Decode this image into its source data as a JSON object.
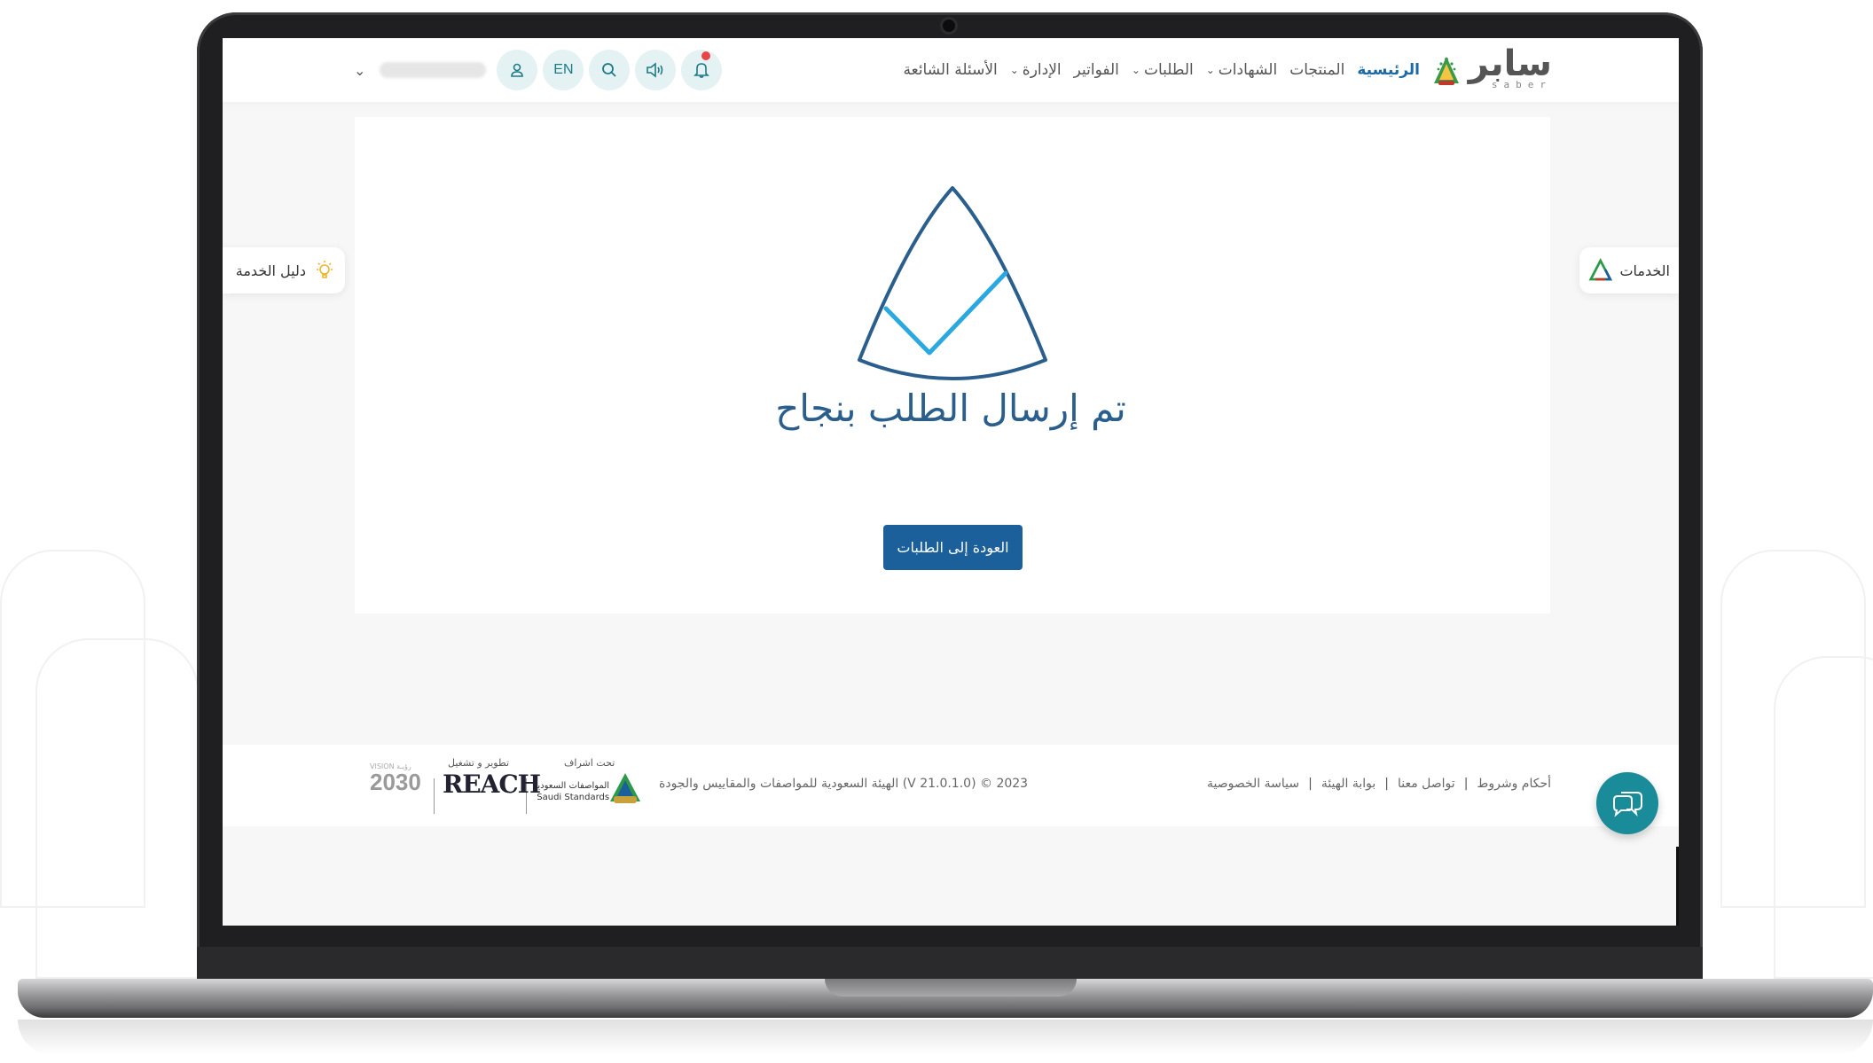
{
  "nav": {
    "logo_arabic": "سابر",
    "logo_latin": "saber",
    "items": [
      {
        "label": "الرئيسية",
        "active": true,
        "dropdown": false
      },
      {
        "label": "المنتجات",
        "active": false,
        "dropdown": false
      },
      {
        "label": "الشهادات",
        "active": false,
        "dropdown": true
      },
      {
        "label": "الطلبات",
        "active": false,
        "dropdown": true
      },
      {
        "label": "الفواتير",
        "active": false,
        "dropdown": false
      },
      {
        "label": "الإدارة",
        "active": false,
        "dropdown": true
      },
      {
        "label": "الأسئلة الشائعة",
        "active": false,
        "dropdown": false
      }
    ],
    "language_button": "EN",
    "icons": {
      "notifications": "bell-icon",
      "sound": "speaker-icon",
      "search": "search-icon",
      "user": "user-icon",
      "user_menu": "chevron-down-icon"
    }
  },
  "side_tabs": {
    "right_label": "الخدمات",
    "left_label": "دليل الخدمة"
  },
  "main": {
    "success_title": "تم إرسال الطلب بنجاح",
    "back_button": "العودة إلى الطلبات"
  },
  "footer": {
    "links": [
      "أحكام وشروط",
      "تواصل معنا",
      "بوابة الهيئة",
      "سياسة الخصوصية"
    ],
    "separator": "|",
    "copyright": "الهيئة السعودية للمواصفات والمقاييس والجودة (V 21.0.1.0) © 2023",
    "supervision_caption": "تحت اشراف",
    "operation_caption": "تطوير و تشغيل",
    "saso_arabic": "المواصفات السعودية",
    "saso_english": "Saudi Standards",
    "saso_badge": "SASO",
    "reach_logo": "REACH",
    "vision_top": "VISION رؤيـة",
    "vision_year": "2030"
  },
  "colors": {
    "primary": "#1b5f9b",
    "accent_teal": "#1a8b98",
    "title": "#2a5e8c",
    "check": "#2aa8e0",
    "notification_dot": "#e84646"
  }
}
